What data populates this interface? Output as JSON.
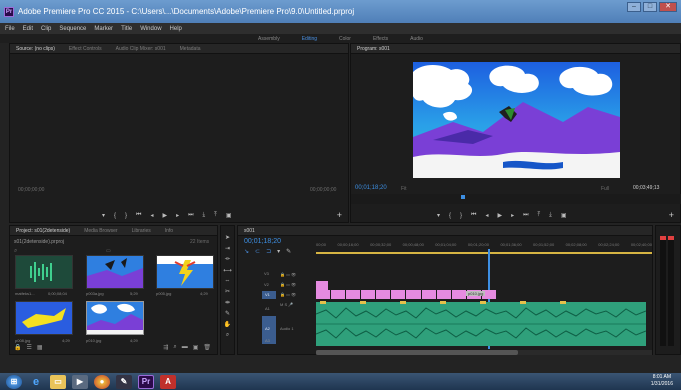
{
  "window": {
    "title": "Adobe Premiere Pro CC 2015 - C:\\Users\\...\\Documents\\Adobe\\Premiere Pro\\9.0\\Untitled.prproj"
  },
  "menu": [
    "File",
    "Edit",
    "Clip",
    "Sequence",
    "Marker",
    "Title",
    "Window",
    "Help"
  ],
  "workspaces": {
    "items": [
      "Assembly",
      "Editing",
      "Color",
      "Effects",
      "Audio"
    ],
    "active": "Editing"
  },
  "source_panel": {
    "tabs": [
      "Source: (no clips)",
      "Effect Controls",
      "Audio Clip Mixer: s001",
      "Metadata"
    ],
    "timecode_left": "00;00;00;00",
    "timecode_right": "00;00;00;00"
  },
  "program_panel": {
    "tab": "Program: s001",
    "timecode": "00;01;18;20",
    "fit": "Fit",
    "quality": "Full",
    "duration": "00;03;49;13"
  },
  "project_panel": {
    "tabs": [
      "Project: s01(2detenside)",
      "Media Browser",
      "Libraries",
      "Info"
    ],
    "project_file": "s01(2detenside).prproj",
    "items_count": "22 Items",
    "items": [
      {
        "name": "matfeks1...",
        "info": "0;00;08;04",
        "kind": "audio"
      },
      {
        "name": "p003a.jpg",
        "info": "5;29",
        "kind": "image-bat"
      },
      {
        "name": "p005.jpg",
        "info": "4;29",
        "kind": "image-lightning"
      },
      {
        "name": "p008.jpg",
        "info": "4;29",
        "kind": "image-shark"
      },
      {
        "name": "p010.jpg",
        "info": "4;29",
        "kind": "image-sky"
      }
    ]
  },
  "timeline": {
    "tab": "s001",
    "timecode": "00;01;18;20",
    "ruler": [
      "00;00",
      "00;00;16;00",
      "00;00;32;00",
      "00;00;48;00",
      "00;01;04;00",
      "00;01;20;00",
      "00;01;36;00",
      "00;01;52;00",
      "00;02;08;00",
      "00;02;24;00",
      "00;02;40;00"
    ],
    "tracks": {
      "video": [
        "V3",
        "V2",
        "V1"
      ],
      "audio": [
        "A1",
        "A2",
        "A3"
      ],
      "audio_label": "Audio 1"
    },
    "clip_label": "p010.jpg"
  },
  "taskbar": {
    "time": "8:01 AM",
    "date": "1/31/2016"
  },
  "colors": {
    "accent": "#3d8fe3",
    "clip_pink": "#e58be0",
    "clip_audio": "#2fa07b",
    "sky_blue": "#2f7fe0"
  }
}
